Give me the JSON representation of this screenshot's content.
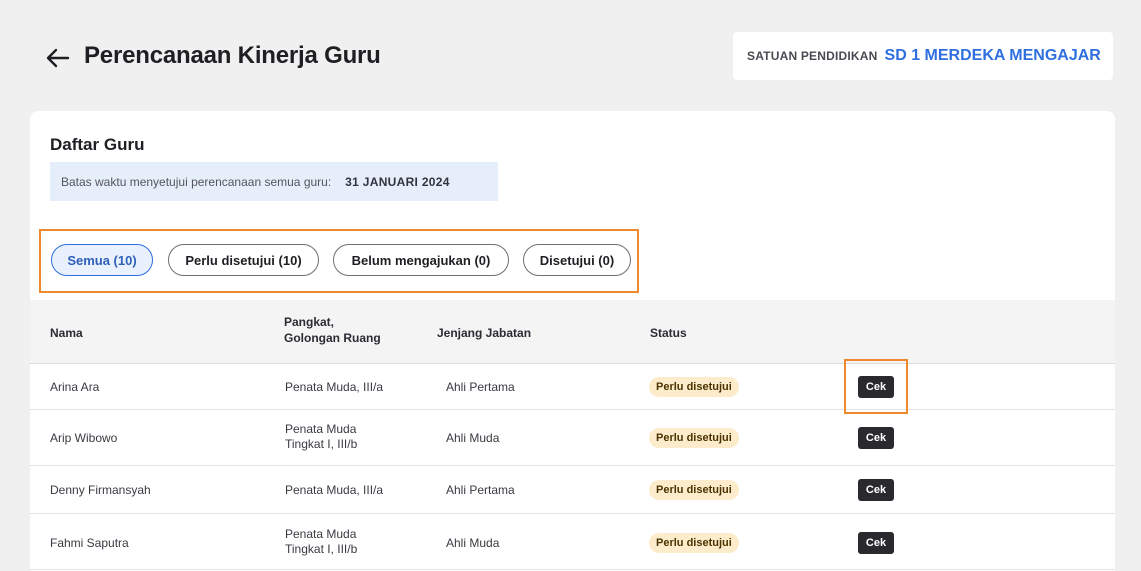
{
  "header": {
    "title": "Perencanaan Kinerja Guru",
    "school_label": "SATUAN PENDIDIKAN",
    "school_name": "SD 1 MERDEKA MENGAJAR"
  },
  "card": {
    "title": "Daftar Guru",
    "deadline_label": "Batas waktu menyetujui perencanaan semua guru:",
    "deadline_date": "31 JANUARI 2024"
  },
  "tabs": [
    {
      "label": "Semua (10)",
      "active": true
    },
    {
      "label": "Perlu disetujui (10)",
      "active": false
    },
    {
      "label": "Belum mengajukan (0)",
      "active": false
    },
    {
      "label": "Disetujui (0)",
      "active": false
    }
  ],
  "table": {
    "headers": {
      "name": "Nama",
      "rank_line1": "Pangkat,",
      "rank_line2": "Golongan Ruang",
      "level": "Jenjang Jabatan",
      "status": "Status"
    },
    "rows": [
      {
        "name": "Arina Ara",
        "rank_line1": "Penata Muda, III/a",
        "rank_line2": "",
        "level": "Ahli Pertama",
        "status": "Perlu disetujui",
        "action": "Cek"
      },
      {
        "name": "Arip Wibowo",
        "rank_line1": "Penata Muda",
        "rank_line2": "Tingkat I, III/b",
        "level": "Ahli Muda",
        "status": "Perlu disetujui",
        "action": "Cek"
      },
      {
        "name": "Denny Firmansyah",
        "rank_line1": "Penata Muda, III/a",
        "rank_line2": "",
        "level": "Ahli Pertama",
        "status": "Perlu disetujui",
        "action": "Cek"
      },
      {
        "name": "Fahmi Saputra",
        "rank_line1": "Penata Muda",
        "rank_line2": "Tingkat I, III/b",
        "level": "Ahli Muda",
        "status": "Perlu disetujui",
        "action": "Cek"
      }
    ]
  },
  "colors": {
    "accent": "#2f6fe0",
    "highlight": "#ee8a2c",
    "badge_bg": "#fdeccb"
  }
}
